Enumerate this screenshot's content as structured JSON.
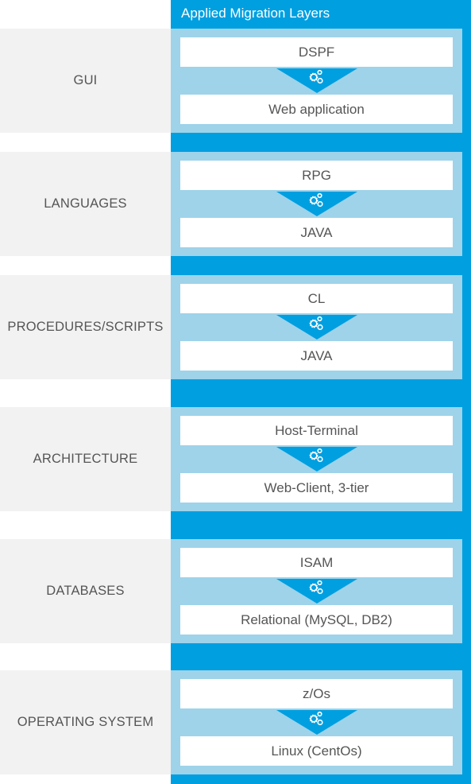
{
  "header": {
    "title": "Applied Migration Layers"
  },
  "colors": {
    "accent_blue": "#009fe0",
    "panel_light_blue": "#9ed3ea",
    "label_bg": "#f2f2f2",
    "text": "#555555"
  },
  "rows": [
    {
      "label": "GUI",
      "from": "DSPF",
      "to": "Web application",
      "icon": "gears-icon"
    },
    {
      "label": "LANGUAGES",
      "from": "RPG",
      "to": "JAVA",
      "icon": "gears-icon"
    },
    {
      "label": "PROCEDURES/SCRIPTS",
      "from": "CL",
      "to": "JAVA",
      "icon": "gears-icon"
    },
    {
      "label": "ARCHITECTURE",
      "from": "Host-Terminal",
      "to": "Web-Client, 3-tier",
      "icon": "gears-icon"
    },
    {
      "label": "DATABASES",
      "from": "ISAM",
      "to": "Relational (MySQL, DB2)",
      "icon": "gears-icon"
    },
    {
      "label": "OPERATING SYSTEM",
      "from": "z/Os",
      "to": "Linux (CentOs)",
      "icon": "gears-icon"
    }
  ]
}
